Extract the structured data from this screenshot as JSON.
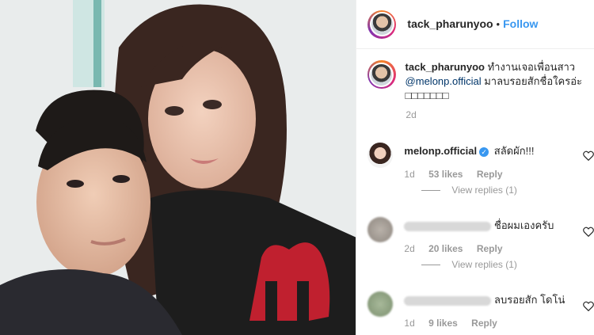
{
  "post": {
    "username": "tack_pharunyoo",
    "follow_label": "Follow",
    "separator": "•",
    "caption_text": "ทำงานเจอเพื่อนสาว",
    "caption_mention": "@melonp.official",
    "caption_rest": "มาลบรอยสักชื่อใครอ่ะ",
    "caption_emoji": "□□□□□□□",
    "time": "2d"
  },
  "comments": [
    {
      "username": "melonp.official",
      "verified": true,
      "text": "สลัดผัก!!!",
      "time": "1d",
      "likes": "53 likes",
      "reply": "Reply",
      "view_replies": "View replies (1)"
    },
    {
      "username": "",
      "verified": false,
      "text": "ชื่อผมเองครับ",
      "time": "2d",
      "likes": "20 likes",
      "reply": "Reply",
      "view_replies": "View replies (1)"
    },
    {
      "username": "",
      "verified": false,
      "text": "ลบรอยสัก โดโน่",
      "time": "1d",
      "likes": "9 likes",
      "reply": "Reply"
    }
  ],
  "colors": {
    "link": "#3897f0",
    "mention": "#003569",
    "muted": "#999999",
    "jersey_red": "#c0202f"
  }
}
